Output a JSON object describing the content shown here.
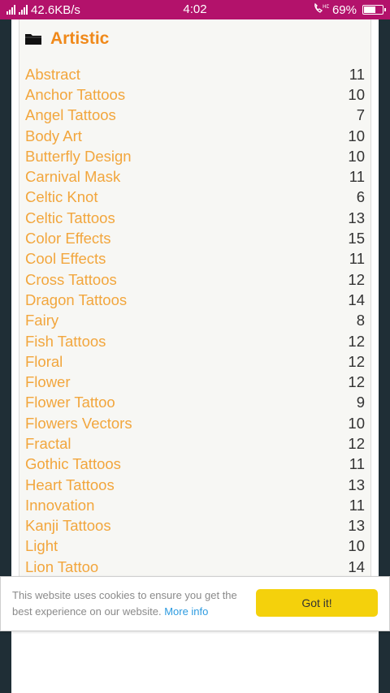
{
  "status_bar": {
    "network_speed": "42.6KB/s",
    "time": "4:02",
    "battery": "69%",
    "battery_level": 0.69,
    "signal_icon": "signal-icon",
    "call_icon": "hd-call-icon"
  },
  "panel": {
    "title": "Artistic",
    "icon": "folder-icon",
    "categories": [
      {
        "name": "Abstract",
        "count": "11"
      },
      {
        "name": "Anchor Tattoos",
        "count": "10"
      },
      {
        "name": "Angel Tattoos",
        "count": "7"
      },
      {
        "name": "Body Art",
        "count": "10"
      },
      {
        "name": "Butterfly Design",
        "count": "10"
      },
      {
        "name": "Carnival Mask",
        "count": "11"
      },
      {
        "name": "Celtic Knot",
        "count": "6"
      },
      {
        "name": "Celtic Tattoos",
        "count": "13"
      },
      {
        "name": "Color Effects",
        "count": "15"
      },
      {
        "name": "Cool Effects",
        "count": "11"
      },
      {
        "name": "Cross Tattoos",
        "count": "12"
      },
      {
        "name": "Dragon Tattoos",
        "count": "14"
      },
      {
        "name": "Fairy",
        "count": "8"
      },
      {
        "name": "Fish Tattoos",
        "count": "12"
      },
      {
        "name": "Floral",
        "count": "12"
      },
      {
        "name": "Flower",
        "count": "12"
      },
      {
        "name": "Flower Tattoo",
        "count": "9"
      },
      {
        "name": "Flowers Vectors",
        "count": "10"
      },
      {
        "name": "Fractal",
        "count": "12"
      },
      {
        "name": "Gothic Tattoos",
        "count": "11"
      },
      {
        "name": "Heart Tattoos",
        "count": "13"
      },
      {
        "name": "Innovation",
        "count": "11"
      },
      {
        "name": "Kanji Tattoos",
        "count": "13"
      },
      {
        "name": "Light",
        "count": "10"
      },
      {
        "name": "Lion Tattoo",
        "count": "14"
      }
    ]
  },
  "cookie_bar": {
    "message": "This website uses cookies to ensure you get the best experience on our website.",
    "link_text": "More info",
    "button_label": "Got it!"
  },
  "colors": {
    "status_bar": "#b3126b",
    "accent_orange": "#f0891a",
    "link_orange": "#f2a63d",
    "button_yellow": "#f4d10c",
    "link_blue": "#2d9be0"
  }
}
